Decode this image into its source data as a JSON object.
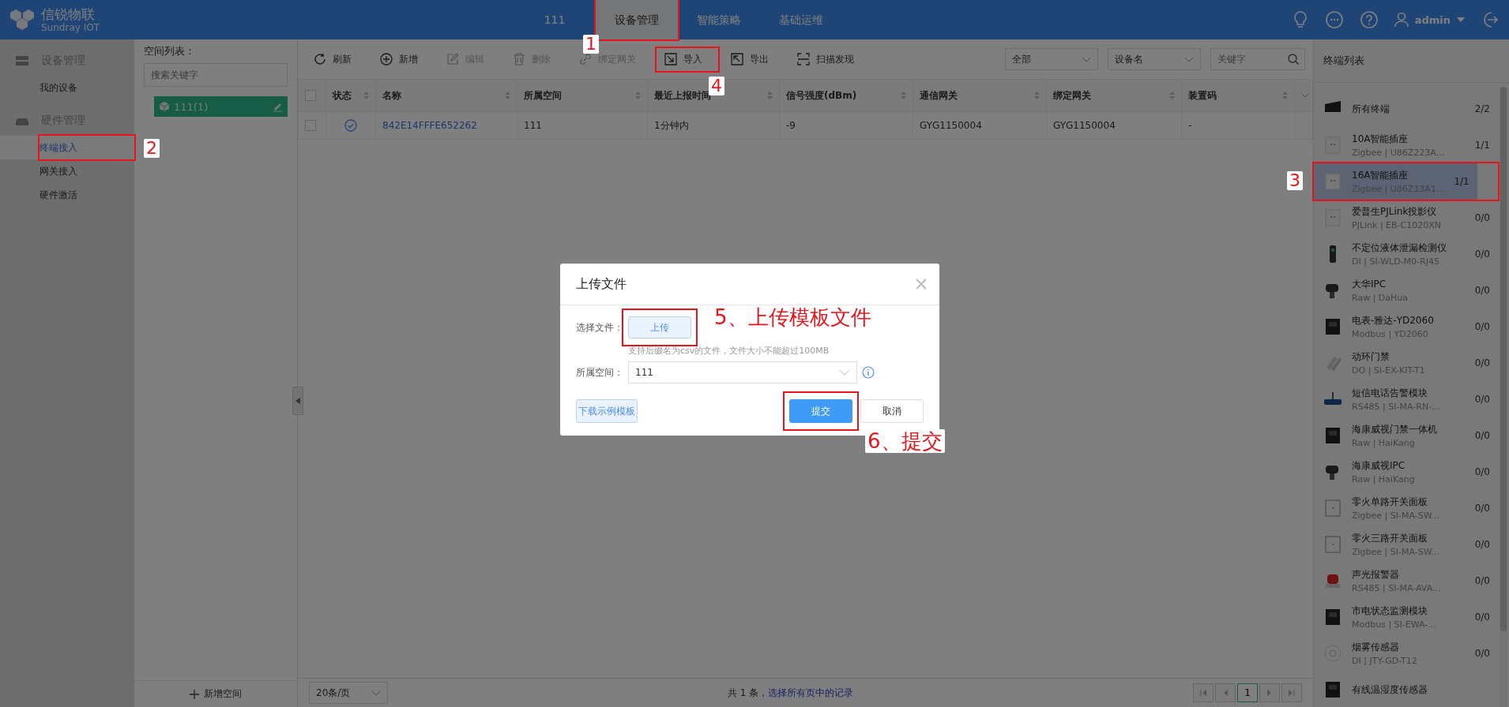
{
  "topbar": {
    "logo_title": "信锐物联",
    "logo_subtitle": "Sundray IOT",
    "tabs": [
      {
        "label": "111",
        "selected": false
      },
      {
        "label": "设备管理",
        "selected": true,
        "annotation": "1"
      },
      {
        "label": "智能策略",
        "selected": false
      },
      {
        "label": "基础运维",
        "selected": false
      }
    ],
    "user": "admin"
  },
  "sidebar": {
    "groups": [
      {
        "kind": "device",
        "label": "设备管理",
        "items": [
          {
            "label": "我的设备",
            "selected": false
          }
        ]
      },
      {
        "kind": "hardware",
        "label": "硬件管理",
        "items": [
          {
            "label": "终端接入",
            "selected": true,
            "annotation": "2"
          },
          {
            "label": "网关接入",
            "selected": false
          },
          {
            "label": "硬件激活",
            "selected": false
          }
        ]
      }
    ]
  },
  "space_panel": {
    "title": "空间列表：",
    "search_placeholder": "搜索关键字",
    "tree": [
      {
        "label": "111(1)",
        "selected": true
      }
    ],
    "add_button": "新增空间"
  },
  "toolbar": {
    "buttons": [
      {
        "kind": "refresh",
        "label": "刷新",
        "disabled": false
      },
      {
        "kind": "add",
        "label": "新增",
        "disabled": false
      },
      {
        "kind": "edit",
        "label": "编辑",
        "disabled": true
      },
      {
        "kind": "delete",
        "label": "删除",
        "disabled": true
      },
      {
        "kind": "link",
        "label": "绑定网关",
        "disabled": true
      },
      {
        "kind": "import",
        "label": "导入",
        "disabled": false,
        "annotation": "4"
      },
      {
        "kind": "export",
        "label": "导出",
        "disabled": false
      },
      {
        "kind": "scan",
        "label": "扫描发现",
        "disabled": false
      }
    ],
    "filter": "全部",
    "field": "设备名",
    "search_placeholder": "关键字"
  },
  "table": {
    "all_checked": false,
    "columns": [
      "状态",
      "名称",
      "所属空间",
      "最近上报时间",
      "信号强度(dBm)",
      "通信网关",
      "绑定网关",
      "装置码"
    ],
    "rows": [
      {
        "checked": false,
        "online": true,
        "cells": [
          "",
          "842E14FFFE652262",
          "111",
          "1分钟内",
          "-9",
          "GYG1150004",
          "GYG1150004",
          "-"
        ]
      }
    ]
  },
  "footer": {
    "page_size": "20条/页",
    "total": "共 1 条，",
    "select_all_link": "选择所有页中的记录",
    "page": "1"
  },
  "terminal_panel": {
    "title": "终端列表",
    "items": [
      {
        "kind": "all",
        "name": "所有终端",
        "count": "2/2",
        "selected": false
      },
      {
        "kind": "socket",
        "name": "10A智能插座",
        "sub": "Zigbee | U86Z223A...",
        "count": "1/1",
        "selected": false
      },
      {
        "kind": "socket",
        "name": "16A智能插座",
        "sub": "Zigbee | U86Z13A1...",
        "count": "1/1",
        "selected": true,
        "annotation": "3"
      },
      {
        "kind": "socket",
        "name": "爱普生PJLink投影仪",
        "sub": "PJLink | EB-C1020XN",
        "count": "0/0",
        "selected": false
      },
      {
        "kind": "sensor",
        "name": "不定位液体泄漏检测仪",
        "sub": "DI | SI-WLD-M0-RJ45",
        "count": "0/0",
        "selected": false
      },
      {
        "kind": "camera",
        "name": "大华IPC",
        "sub": "Raw | DaHua",
        "count": "0/0",
        "selected": false
      },
      {
        "kind": "meter",
        "name": "电表-雅达-YD2060",
        "sub": "Modbus | YD2060",
        "count": "0/0",
        "selected": false
      },
      {
        "kind": "door",
        "name": "动环门禁",
        "sub": "DO | SI-EX-KIT-T1",
        "count": "0/0",
        "selected": false
      },
      {
        "kind": "router",
        "name": "短信电话告警模块",
        "sub": "RS485 | SI-MA-RN-...",
        "count": "0/0",
        "selected": false
      },
      {
        "kind": "meter",
        "name": "海康威视门禁一体机",
        "sub": "Raw | HaiKang",
        "count": "0/0",
        "selected": false
      },
      {
        "kind": "camera",
        "name": "海康威视IPC",
        "sub": "Raw | HaiKang",
        "count": "0/0",
        "selected": false
      },
      {
        "kind": "switch",
        "name": "零火单路开关面板",
        "sub": "Zigbee | SI-MA-SW...",
        "count": "0/0",
        "selected": false
      },
      {
        "kind": "switch",
        "name": "零火三路开关面板",
        "sub": "Zigbee | SI-MA-SW...",
        "count": "0/0",
        "selected": false
      },
      {
        "kind": "alarm",
        "name": "声光报警器",
        "sub": "RS485 | SI-MA-AVA...",
        "count": "0/0",
        "selected": false
      },
      {
        "kind": "meter",
        "name": "市电状态监测模块",
        "sub": "Modbus | SI-EWA-...",
        "count": "0/0",
        "selected": false
      },
      {
        "kind": "smoke",
        "name": "烟雾传感器",
        "sub": "DI | JTY-GD-T12",
        "count": "0/0",
        "selected": false
      },
      {
        "kind": "meter",
        "name": "有线温湿度传感器",
        "selected": false
      }
    ]
  },
  "dialog": {
    "title": "上传文件",
    "file_label": "选择文件：",
    "upload_button": "上传",
    "upload_annotation": "5、上传模板文件",
    "hint": "支持后缀名为csv的文件，文件大小不能超过100MB",
    "space_label": "所属空间：",
    "space_value": "111",
    "download_button": "下载示例模板",
    "submit_button": "提交",
    "submit_annotation": "6、提交",
    "cancel_button": "取消"
  }
}
